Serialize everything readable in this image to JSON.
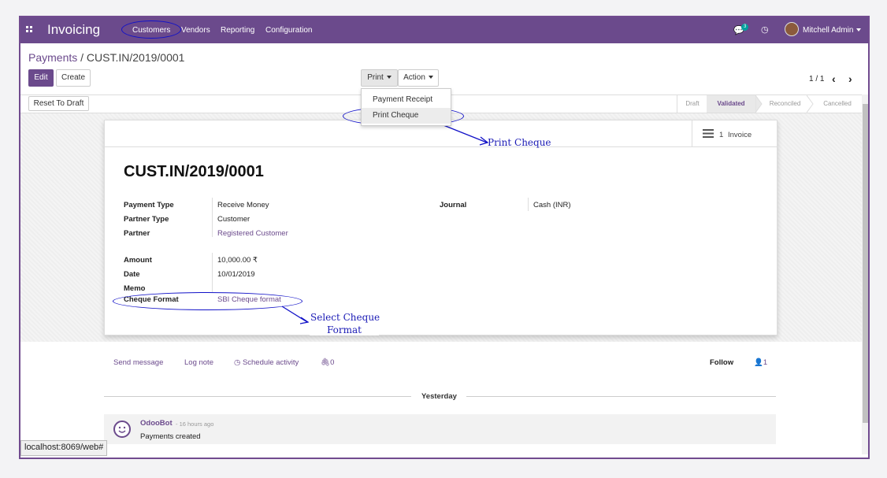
{
  "app": {
    "name": "Invoicing"
  },
  "nav": {
    "customers": "Customers",
    "vendors": "Vendors",
    "reporting": "Reporting",
    "configuration": "Configuration"
  },
  "systray": {
    "chat_count": "3",
    "user": "Mitchell Admin"
  },
  "breadcrumb": {
    "parent": "Payments",
    "separator": "/",
    "current": "CUST.IN/2019/0001"
  },
  "buttons": {
    "edit": "Edit",
    "create": "Create",
    "print": "Print",
    "action": "Action",
    "reset": "Reset To Draft"
  },
  "print_menu": {
    "items": [
      "Payment Receipt",
      "Print Cheque"
    ]
  },
  "pager": {
    "text": "1 / 1"
  },
  "statusbar": {
    "stages": [
      "Draft",
      "Validated",
      "Reconciled",
      "Cancelled"
    ],
    "current": "Validated"
  },
  "smart_button": {
    "count": "1",
    "label": "Invoice"
  },
  "record": {
    "title": "CUST.IN/2019/0001",
    "fields": {
      "payment_type": {
        "label": "Payment Type",
        "value": "Receive Money"
      },
      "partner_type": {
        "label": "Partner Type",
        "value": "Customer"
      },
      "partner": {
        "label": "Partner",
        "value": "Registered Customer"
      },
      "journal": {
        "label": "Journal",
        "value": "Cash (INR)"
      },
      "amount": {
        "label": "Amount",
        "value": "10,000.00 ₹"
      },
      "date": {
        "label": "Date",
        "value": "10/01/2019"
      },
      "memo": {
        "label": "Memo",
        "value": ""
      },
      "cheque_format": {
        "label": "Cheque Format",
        "value": "SBI Cheque format"
      }
    }
  },
  "annotations": {
    "print_cheque": "Print Cheque",
    "select_line1": "Select Cheque",
    "select_line2": "Format"
  },
  "chatter": {
    "send_message": "Send message",
    "log_note": "Log note",
    "schedule": "Schedule activity",
    "attachments": "0",
    "follow": "Follow",
    "followers": "1",
    "date_divider": "Yesterday",
    "message": {
      "author": "OdooBot",
      "time": "- 16 hours ago",
      "body": "Payments created"
    }
  },
  "status_url": "localhost:8069/web#",
  "colors": {
    "brand": "#6b4a8c",
    "annotation": "#1a1ab5"
  }
}
